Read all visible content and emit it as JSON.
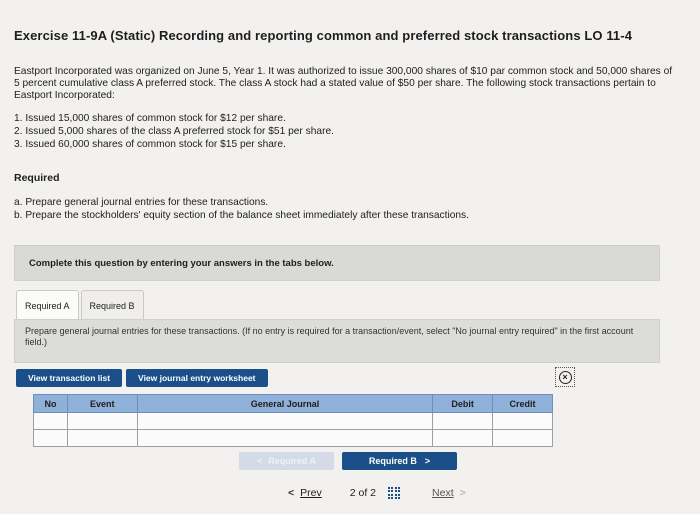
{
  "header": {
    "title": "Exercise 11-9A (Static) Recording and reporting common and preferred stock transactions LO 11-4"
  },
  "problem": {
    "intro": "Eastport Incorporated was organized on June 5, Year 1. It was authorized to issue 300,000 shares of $10 par common stock and 50,000 shares of 5 percent cumulative class A preferred stock. The class A stock had a stated value of $50 per share. The following stock transactions pertain to Eastport Incorporated:",
    "transactions": [
      "1. Issued 15,000 shares of common stock for $12 per share.",
      "2. Issued 5,000 shares of the class A preferred stock for $51 per share.",
      "3. Issued 60,000 shares of common stock for $15 per share."
    ],
    "required_heading": "Required",
    "required_items": [
      "a. Prepare general journal entries for these transactions.",
      "b. Prepare the stockholders' equity section of the balance sheet immediately after these transactions."
    ]
  },
  "banner": {
    "text": "Complete this question by entering your answers in the tabs below."
  },
  "tabs": [
    "Required A",
    "Required B"
  ],
  "panel": {
    "instruction": "Prepare general journal entries for these transactions. (If no entry is required for a transaction/event, select \"No journal entry required\" in the first account field.)"
  },
  "buttons": {
    "view_transaction_list": "View transaction list",
    "view_journal_worksheet": "View journal entry worksheet"
  },
  "help_icon": "close-circle-icon",
  "journal": {
    "columns": [
      "No",
      "Event",
      "General Journal",
      "Debit",
      "Credit"
    ],
    "rows": [
      [
        "",
        "",
        "",
        "",
        ""
      ],
      [
        "",
        "",
        "",
        "",
        ""
      ]
    ]
  },
  "nav": {
    "prev_tab": "Required A",
    "next_tab": "Required B",
    "prev_chevron": "<",
    "next_chevron": ">"
  },
  "pager": {
    "prev": "Prev",
    "pages": "2 of 2",
    "next": "Next",
    "prev_chevron": "<",
    "next_chevron": ">"
  },
  "colors": {
    "accent": "#1b4f8a",
    "table_header": "#8fb0d9"
  }
}
